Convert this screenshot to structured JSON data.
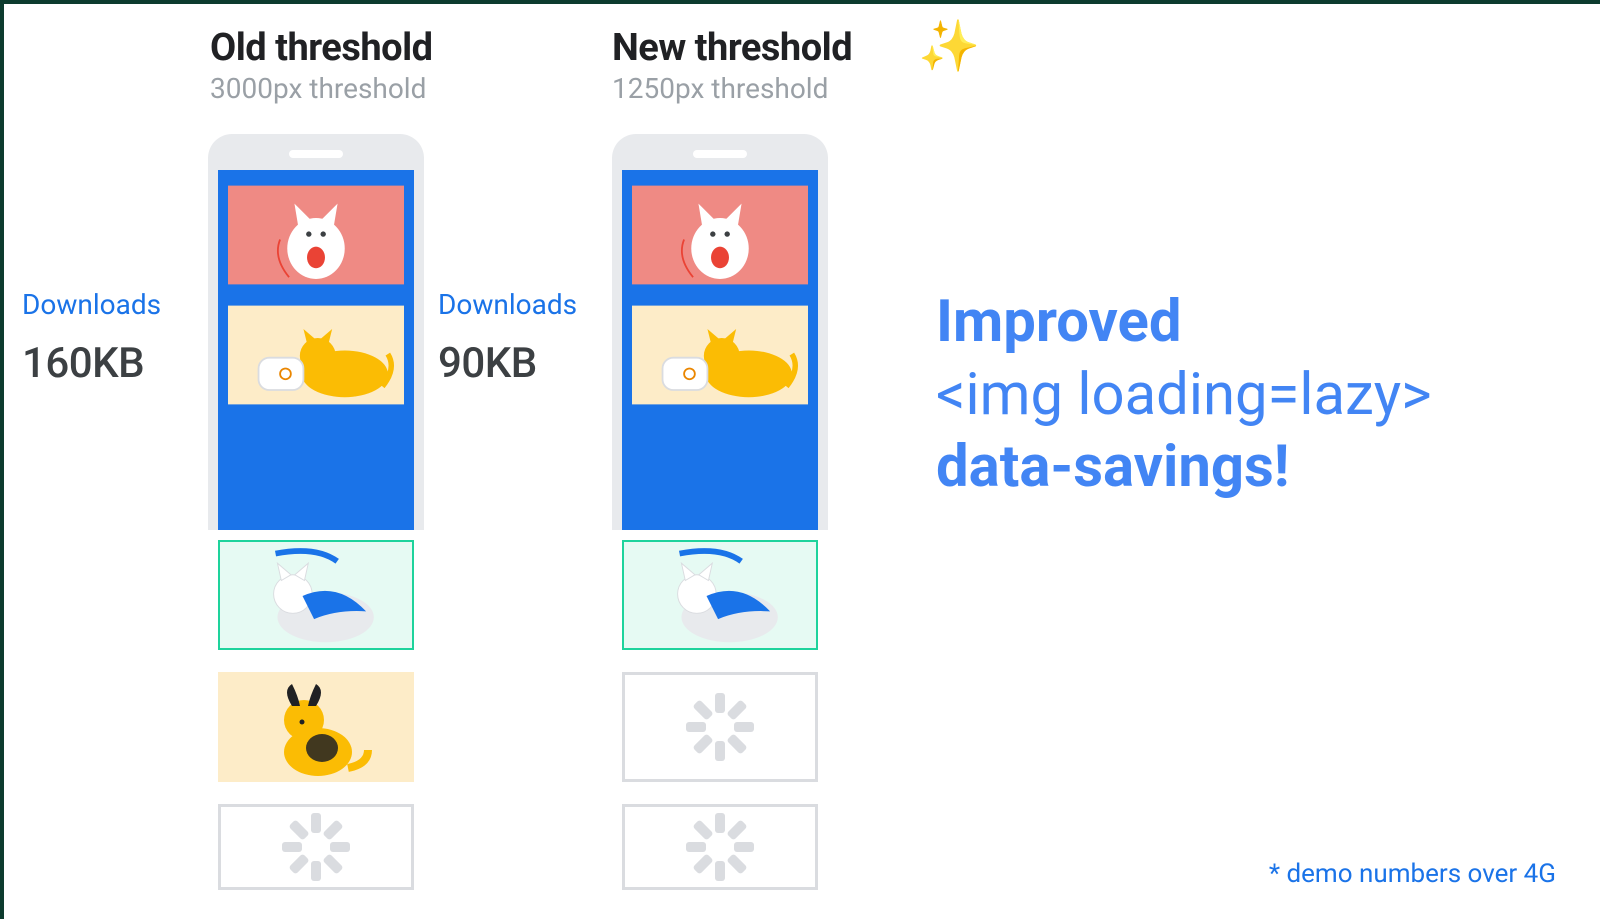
{
  "columns": {
    "old": {
      "title": "Old threshold",
      "subtitle": "3000px threshold",
      "download_label": "Downloads",
      "download_value": "160KB"
    },
    "new": {
      "title": "New threshold",
      "subtitle": "1250px threshold",
      "download_label": "Downloads",
      "download_value": "90KB"
    }
  },
  "headline": {
    "line1": "Improved",
    "line2": "<img loading=lazy>",
    "line3": "data-savings!"
  },
  "footnote": "* demo numbers over 4G",
  "icons": {
    "sparkle": "✨",
    "cards": {
      "cat_yarn": "cat-with-yarn",
      "cat_shoe": "orange-cat-with-shoe",
      "cat_cape": "cat-with-blue-cape",
      "dog_sit": "yellow-dog-sitting",
      "spinner": "loading-spinner"
    }
  }
}
